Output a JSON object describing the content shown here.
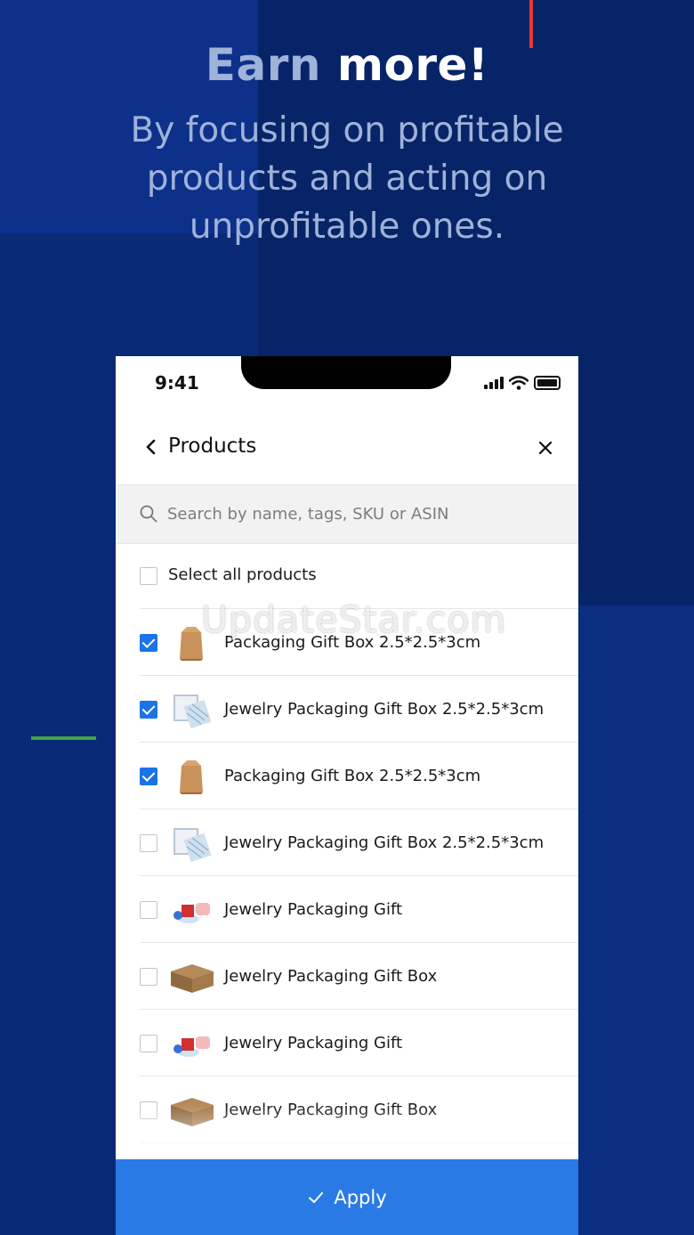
{
  "promo": {
    "headline_dim": "Earn",
    "headline_bright": "more!",
    "subtitle": "By focusing on profitable products and acting on unprofitable ones."
  },
  "status_bar": {
    "time": "9:41"
  },
  "nav": {
    "title": "Products",
    "back_icon": "chevron-left-icon",
    "close_icon": "close-icon"
  },
  "search": {
    "placeholder": "Search by name, tags, SKU or ASIN",
    "value": "",
    "icon": "search-icon"
  },
  "select_all": {
    "label": "Select all products",
    "checked": false
  },
  "products": [
    {
      "name": "Packaging Gift Box 2.5*2.5*3cm",
      "checked": true,
      "thumb": "kraft-box-icon"
    },
    {
      "name": "Jewelry Packaging Gift Box 2.5*2.5*3cm",
      "checked": true,
      "thumb": "bag-icon"
    },
    {
      "name": "Packaging Gift Box 2.5*2.5*3cm",
      "checked": true,
      "thumb": "kraft-box-icon"
    },
    {
      "name": "Jewelry Packaging Gift Box 2.5*2.5*3cm",
      "checked": false,
      "thumb": "bag-icon"
    },
    {
      "name": "Jewelry Packaging Gift",
      "checked": false,
      "thumb": "gift-set-icon"
    },
    {
      "name": "Jewelry Packaging Gift Box",
      "checked": false,
      "thumb": "flat-box-icon"
    },
    {
      "name": "Jewelry Packaging Gift",
      "checked": false,
      "thumb": "gift-set-icon"
    },
    {
      "name": "Jewelry Packaging Gift Box",
      "checked": false,
      "thumb": "flat-box-icon"
    }
  ],
  "apply_button": {
    "label": "Apply",
    "icon": "check-icon"
  },
  "watermark": "UpdateStar.com",
  "colors": {
    "background": "#0a2a78",
    "accent_blue": "#2a7ae6",
    "checkbox_blue": "#1a73e8",
    "red_accent": "#e53935",
    "green_accent": "#43a047"
  }
}
